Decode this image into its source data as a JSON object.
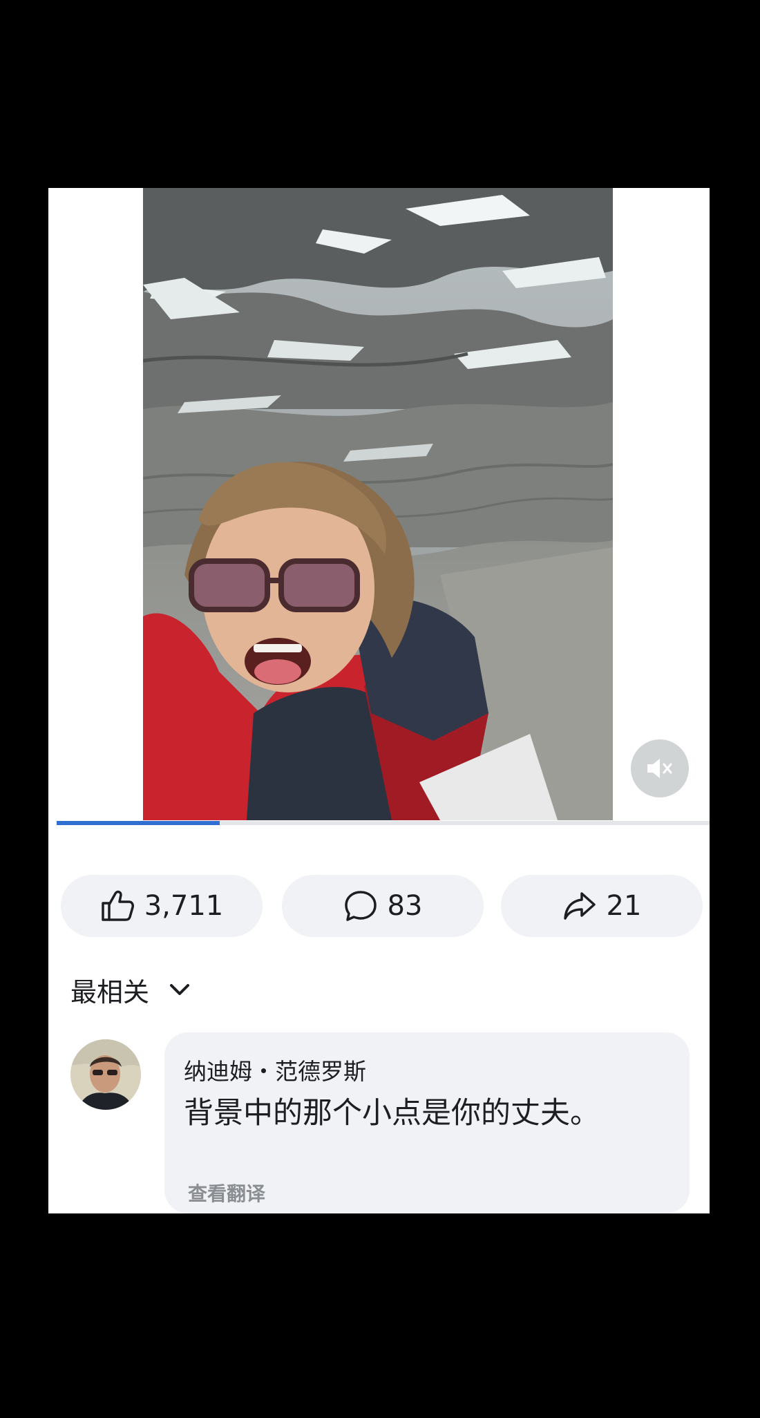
{
  "post": {
    "video": {
      "description": "",
      "progress_fraction": 0.25,
      "muted": true
    },
    "actions": {
      "like_count": "3,711",
      "comment_count": "83",
      "share_count": "21"
    }
  },
  "comments_section": {
    "sort_label": "最相关",
    "comments": [
      {
        "author": "纳迪姆・范德罗斯",
        "text": "背景中的那个小点是你的丈夫。",
        "translate_label": "查看翻译"
      }
    ]
  },
  "icons": {
    "like": "thumbs-up-icon",
    "comment": "speech-bubble-icon",
    "share": "share-arrow-icon",
    "sort": "chevron-down-icon",
    "mute": "speaker-muted-icon"
  },
  "colors": {
    "progress": "#2f6fd1",
    "pill_background": "#f0f2f5",
    "muted_text": "#8a8d91"
  }
}
